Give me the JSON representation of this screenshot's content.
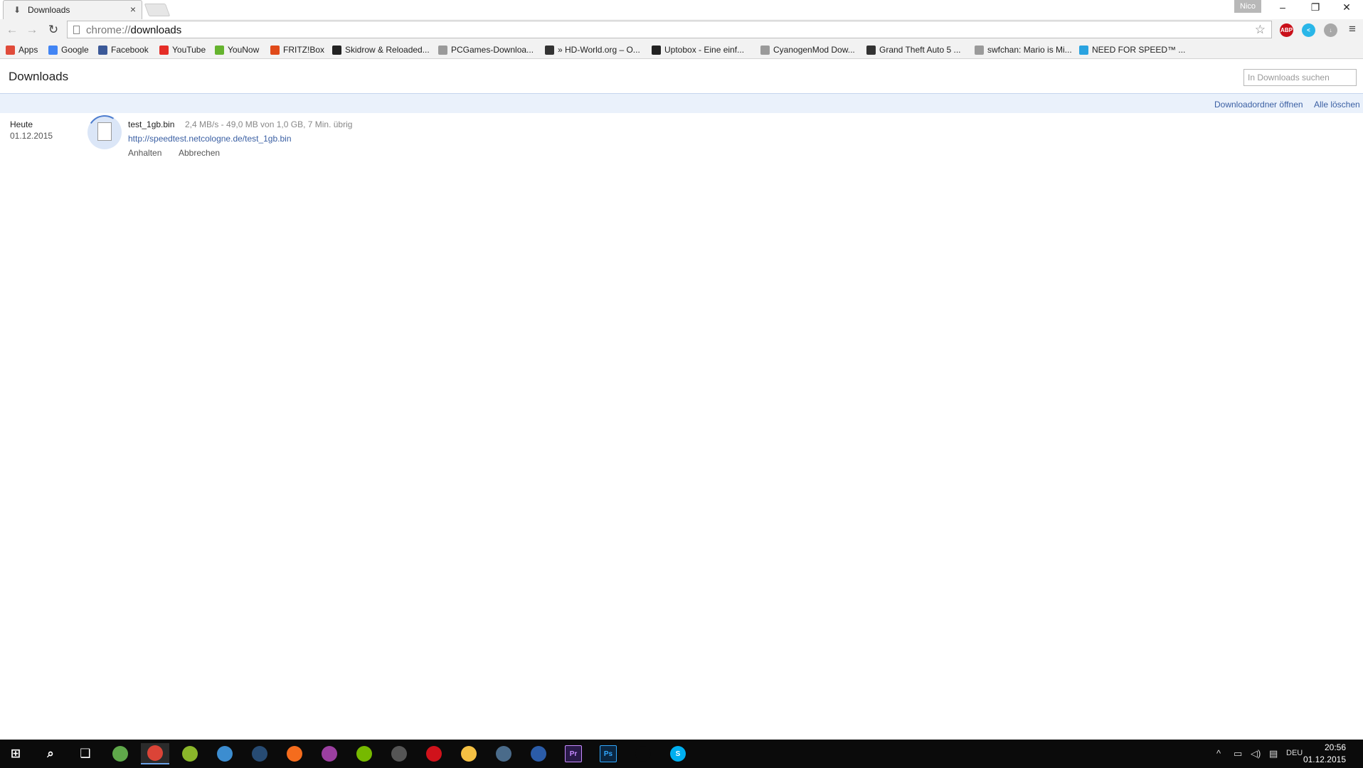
{
  "window": {
    "tab_title": "Downloads",
    "tab_close": "×",
    "profile_name": "Nico",
    "min_symbol": "–",
    "restore_symbol": "❐",
    "close_symbol": "✕"
  },
  "toolbar": {
    "url_scheme": "chrome://",
    "url_path": "downloads",
    "back_symbol": "←",
    "forward_symbol": "→",
    "reload_symbol": "↻",
    "star_symbol": "☆",
    "menu_symbol": "≡",
    "extensions": [
      {
        "name": "adblock-plus-icon",
        "label": "ABP",
        "color": "#c9101a"
      },
      {
        "name": "share-extension-icon",
        "label": "<",
        "color": "#29b6e8"
      },
      {
        "name": "download-extension-icon",
        "label": "↓",
        "color": "#a8a8a8"
      }
    ]
  },
  "bookmarks": [
    {
      "label": "Apps",
      "icon": "apps-grid-icon",
      "color": "#e04b3a"
    },
    {
      "label": "Google",
      "icon": "google-icon",
      "color": "#4285f4"
    },
    {
      "label": "Facebook",
      "icon": "facebook-icon",
      "color": "#3b5998"
    },
    {
      "label": "YouTube",
      "icon": "youtube-icon",
      "color": "#e52d27"
    },
    {
      "label": "YouNow",
      "icon": "younow-icon",
      "color": "#65b32e"
    },
    {
      "label": "FRITZ!Box",
      "icon": "fritzbox-icon",
      "color": "#e04a1a"
    },
    {
      "label": "Skidrow & Reloaded...",
      "icon": "skidrow-icon",
      "color": "#222222"
    },
    {
      "label": "PCGames-Downloa...",
      "icon": "pcgames-icon",
      "color": "#9a9a9a"
    },
    {
      "label": "» HD-World.org – O...",
      "icon": "hd-world-icon",
      "color": "#333333"
    },
    {
      "label": "Uptobox - Eine einf...",
      "icon": "uptobox-icon",
      "color": "#222222"
    },
    {
      "label": "CyanogenMod Dow...",
      "icon": "page-icon",
      "color": "#9a9a9a"
    },
    {
      "label": "Grand Theft Auto 5 ...",
      "icon": "gta-icon",
      "color": "#333333"
    },
    {
      "label": "swfchan: Mario is Mi...",
      "icon": "page-icon",
      "color": "#9a9a9a"
    },
    {
      "label": "NEED FOR SPEED™ ...",
      "icon": "nfs-icon",
      "color": "#2aa3e0"
    }
  ],
  "downloads_page": {
    "title": "Downloads",
    "search_placeholder": "In Downloads suchen",
    "open_folder": "Downloadordner öffnen",
    "clear_all": "Alle löschen",
    "items": [
      {
        "date_label": "Heute",
        "date": "01.12.2015",
        "file_name": "test_1gb.bin",
        "status": "2,4 MB/s - 49,0 MB von 1,0 GB, 7 Min. übrig",
        "url": "http://speedtest.netcologne.de/test_1gb.bin",
        "pause_label": "Anhalten",
        "cancel_label": "Abbrechen",
        "progress": 0.049
      }
    ]
  },
  "taskbar": {
    "apps": [
      {
        "name": "start-button",
        "label": "⊞",
        "color": "#0b0b0b"
      },
      {
        "name": "search-taskbar-icon",
        "label": "⌕",
        "color": "#0b0b0b"
      },
      {
        "name": "task-view-icon",
        "label": "❑",
        "color": "#0b0b0b"
      },
      {
        "name": "globe-app-icon",
        "label": "",
        "color": "#5fa84a"
      },
      {
        "name": "chrome-taskbar-icon",
        "label": "",
        "color": "#db4437"
      },
      {
        "name": "java-app-icon",
        "label": "",
        "color": "#8ab62a"
      },
      {
        "name": "uplay-app-icon",
        "label": "",
        "color": "#3c8dd0"
      },
      {
        "name": "steam-app-icon",
        "label": "",
        "color": "#274b73"
      },
      {
        "name": "origin-app-icon",
        "label": "",
        "color": "#f56c1d"
      },
      {
        "name": "game-app-icon",
        "label": "",
        "color": "#9b3fa0"
      },
      {
        "name": "nvidia-app-icon",
        "label": "",
        "color": "#76b900"
      },
      {
        "name": "notepad-app-icon",
        "label": "",
        "color": "#555555"
      },
      {
        "name": "record-app-icon",
        "label": "",
        "color": "#d0121b"
      },
      {
        "name": "file-explorer-icon",
        "label": "",
        "color": "#f4c043"
      },
      {
        "name": "teamspeak-app-icon",
        "label": "",
        "color": "#4a6b8a"
      },
      {
        "name": "cinema4d-app-icon",
        "label": "",
        "color": "#2b5ca8"
      },
      {
        "name": "premiere-app-icon",
        "label": "Pr",
        "color": "#2a1a4a"
      },
      {
        "name": "photoshop-app-icon",
        "label": "Ps",
        "color": "#0a2540"
      },
      {
        "name": "fan-app-icon",
        "label": "",
        "color": "#0b0b0b"
      },
      {
        "name": "skype-app-icon",
        "label": "S",
        "color": "#00aff0"
      }
    ],
    "language": "DEU",
    "time": "20:56",
    "date": "01.12.2015"
  }
}
